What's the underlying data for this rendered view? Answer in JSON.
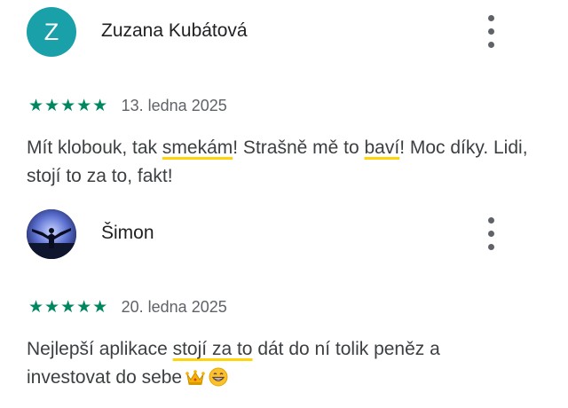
{
  "reviews": [
    {
      "author": "Zuzana Kubátová",
      "avatar_letter": "Z",
      "avatar_color": "#1aa0a8",
      "stars": "★★★★★",
      "rating": 5,
      "date": "13. ledna 2025",
      "text_parts": [
        "Mít klobouk, tak ",
        "smekám",
        "! Strašně mě to ",
        "baví",
        "! Moc díky. Lidi, stojí to za to, fakt!"
      ]
    },
    {
      "author": "Šimon",
      "stars": "★★★★★",
      "rating": 5,
      "date": "20. ledna 2025",
      "text_parts": [
        "Nejlepší aplikace ",
        "stojí za to",
        " dát do ní tolik peněz a investovat do sebe"
      ],
      "emojis": [
        "crown-emoji",
        "grinning-face-emoji"
      ]
    }
  ],
  "colors": {
    "star_green": "#01875f",
    "highlight_yellow": "#ffd50a",
    "text_gray": "#3c4043",
    "secondary_gray": "#5f6368"
  },
  "icons": {
    "more": "more-vert-icon"
  }
}
